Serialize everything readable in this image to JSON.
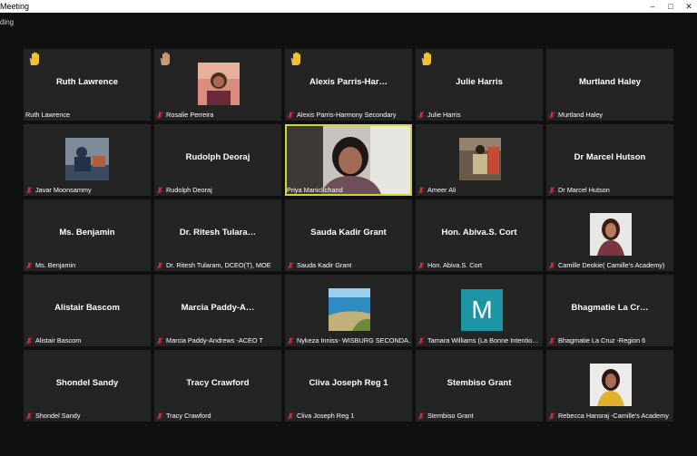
{
  "window": {
    "title": "Meeting",
    "status_fragment": "ding"
  },
  "colors": {
    "tile_bg": "#242424",
    "active_border": "#c9d73a",
    "mute_red": "#e0313b",
    "hand_yellow": "#f2c038",
    "avatar_m": "#1c95a6"
  },
  "participants": [
    {
      "display_name": "Ruth Lawrence",
      "label": "Ruth Lawrence",
      "hand": "yellow",
      "muted": false,
      "video": false
    },
    {
      "display_name": "",
      "label": "Rosalie Perreira",
      "hand": "tan",
      "muted": true,
      "video": true
    },
    {
      "display_name": "Alexis  Parris-Har…",
      "label": "Alexis Parris-Harmony Secondary",
      "hand": "yellow",
      "muted": true,
      "video": false
    },
    {
      "display_name": "Julie Harris",
      "label": "Julie Harris",
      "hand": "yellow",
      "muted": true,
      "video": false
    },
    {
      "display_name": "Murtland Haley",
      "label": "Murtland Haley",
      "muted": true,
      "video": false
    },
    {
      "display_name": "",
      "label": "Javar Moonsammy",
      "muted": true,
      "video": true
    },
    {
      "display_name": "Rudolph Deoraj",
      "label": "Rudolph Deoraj",
      "muted": true,
      "video": false
    },
    {
      "display_name": "",
      "label": "Priya Manickchand",
      "muted": false,
      "video": true,
      "active": true
    },
    {
      "display_name": "",
      "label": "Ameer Ali",
      "muted": true,
      "video": true
    },
    {
      "display_name": "Dr Marcel Hutson",
      "label": "Dr Marcel Hutson",
      "muted": true,
      "video": false
    },
    {
      "display_name": "Ms. Benjamin",
      "label": "Ms. Benjamin",
      "muted": true,
      "video": false
    },
    {
      "display_name": "Dr. Ritesh Tulara…",
      "label": "Dr. Ritesh Tularam, DCEO(T), MOE",
      "muted": true,
      "video": false
    },
    {
      "display_name": "Sauda Kadir Grant",
      "label": "Sauda Kadir Grant",
      "muted": true,
      "video": false
    },
    {
      "display_name": "Hon. Abiva.S. Cort",
      "label": "Hon. Abiva.S. Cort",
      "muted": true,
      "video": false
    },
    {
      "display_name": "",
      "label": "Camille Deokie( Camille's Academy)",
      "muted": true,
      "video": true
    },
    {
      "display_name": "Alistair Bascom",
      "label": "Alistair Bascom",
      "muted": true,
      "video": false
    },
    {
      "display_name": "Marcia  Paddy-A…",
      "label": "Marcia Paddy-Andrews -ACEO T",
      "muted": true,
      "video": false
    },
    {
      "display_name": "",
      "label": "Nykeza Inniss- WISBURG SECONDA…",
      "muted": true,
      "video": true
    },
    {
      "display_name": "",
      "label": "Tamara Williams (La Bonne Intentio…",
      "muted": true,
      "video": false,
      "avatar_letter": "M"
    },
    {
      "display_name": "Bhagmatie La Cr…",
      "label": "Bhagmatie La Cruz -Region 6",
      "muted": true,
      "video": false
    },
    {
      "display_name": "Shondel Sandy",
      "label": "Shondel Sandy",
      "muted": true,
      "video": false
    },
    {
      "display_name": "Tracy Crawford",
      "label": "Tracy Crawford",
      "muted": true,
      "video": false
    },
    {
      "display_name": "Cliva Joseph Reg 1",
      "label": "Cliva Joseph Reg 1",
      "muted": true,
      "video": false
    },
    {
      "display_name": "Stembiso Grant",
      "label": "Stembiso Grant",
      "muted": true,
      "video": false
    },
    {
      "display_name": "",
      "label": "Rebecca Hansraj -Camille's Academy",
      "muted": true,
      "video": true
    }
  ]
}
